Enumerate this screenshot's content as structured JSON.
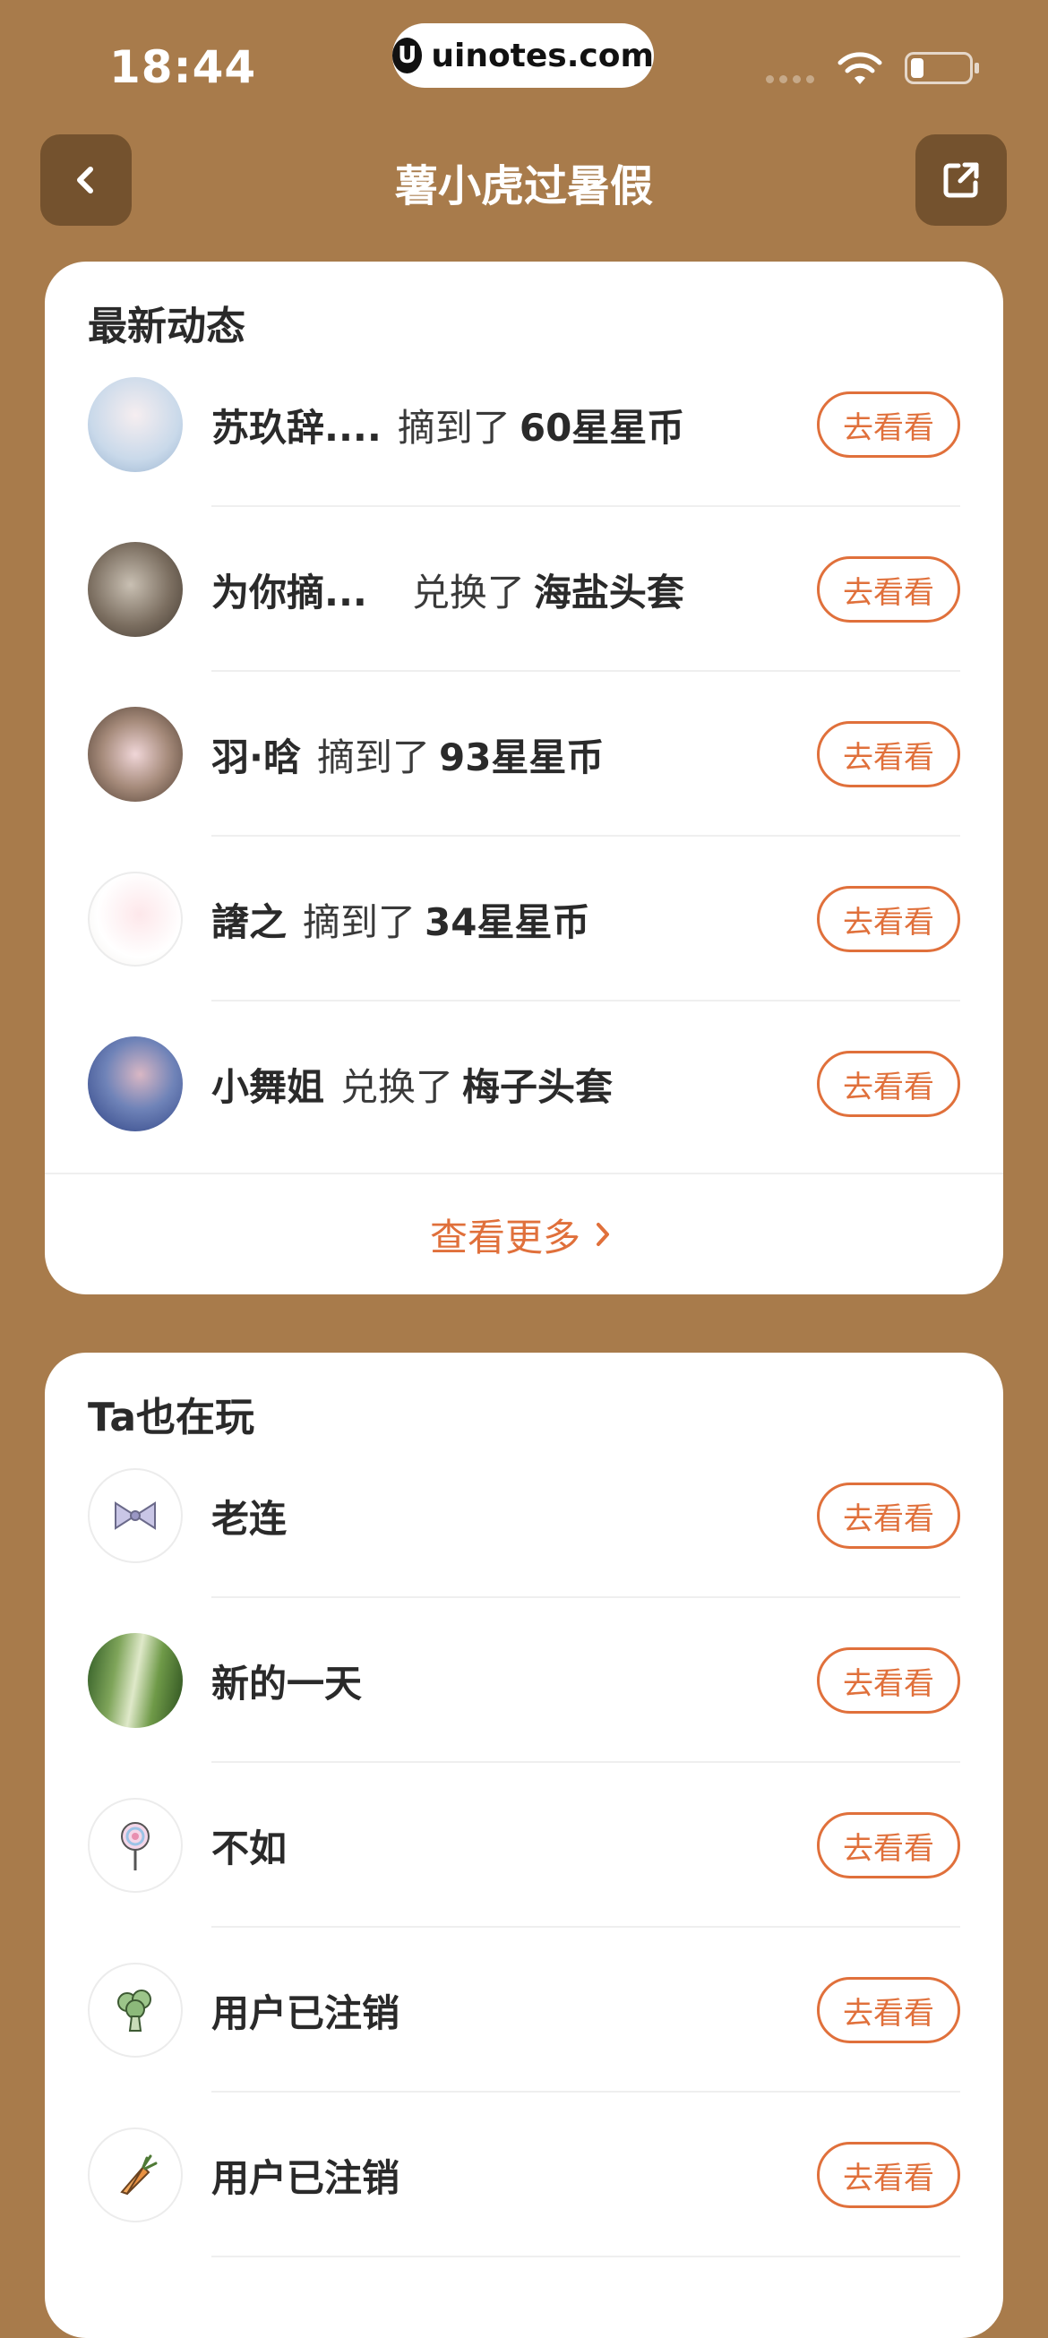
{
  "status_bar": {
    "time": "18:44",
    "url": "uinotes.com"
  },
  "nav": {
    "title": "薯小虎过暑假"
  },
  "latest": {
    "title": "最新动态",
    "rows": [
      {
        "name": "苏玖辞....",
        "action": "摘到了",
        "item": "60星星币",
        "button": "去看看"
      },
      {
        "name": "为你摘...",
        "action": "兑换了",
        "item": "海盐头套",
        "button": "去看看"
      },
      {
        "name": "羽·晗",
        "action": "摘到了",
        "item": "93星星币",
        "button": "去看看"
      },
      {
        "name": "譇之",
        "action": "摘到了",
        "item": "34星星币",
        "button": "去看看"
      },
      {
        "name": "小舞姐",
        "action": "兑换了",
        "item": "梅子头套",
        "button": "去看看"
      }
    ],
    "more_label": "查看更多"
  },
  "also_playing": {
    "title": "Ta也在玩",
    "rows": [
      {
        "name": "老连",
        "icon": "bow-icon",
        "button": "去看看"
      },
      {
        "name": "新的一天",
        "icon": "bamboo-photo",
        "button": "去看看"
      },
      {
        "name": "不如",
        "icon": "lollipop-icon",
        "button": "去看看"
      },
      {
        "name": "用户已注销",
        "icon": "broccoli-icon",
        "button": "去看看"
      },
      {
        "name": "用户已注销",
        "icon": "carrot-icon",
        "button": "去看看"
      }
    ]
  }
}
